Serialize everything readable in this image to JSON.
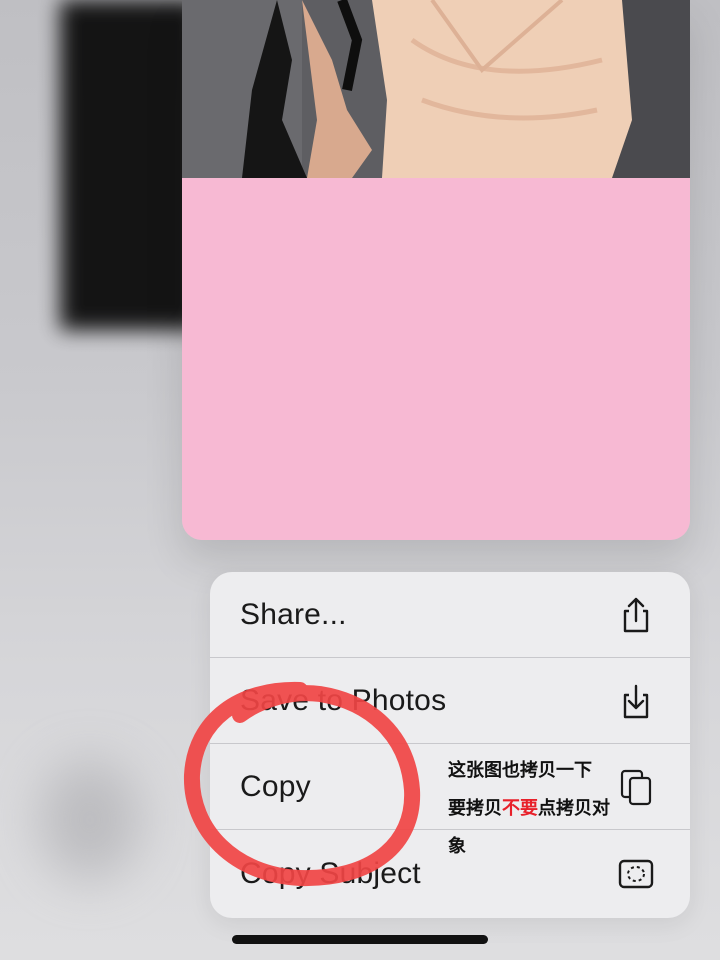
{
  "menu": {
    "items": [
      {
        "label": "Share...",
        "icon": "share-icon"
      },
      {
        "label": "Save to Photos",
        "icon": "save-to-photos-icon"
      },
      {
        "label": "Copy",
        "icon": "copy-icon"
      },
      {
        "label": "Copy Subject",
        "icon": "copy-subject-icon"
      }
    ]
  },
  "annotation": {
    "line1": "这张图也拷贝一下",
    "line2_before": "要拷贝",
    "line2_red": "不要",
    "line2_after": "点拷贝对",
    "line3": "象"
  },
  "colors": {
    "preview_pink": "#f7b9d3",
    "menu_background": "#ededef",
    "annotation_red": "#e8202a",
    "circle_mark_red": "#f04444"
  }
}
